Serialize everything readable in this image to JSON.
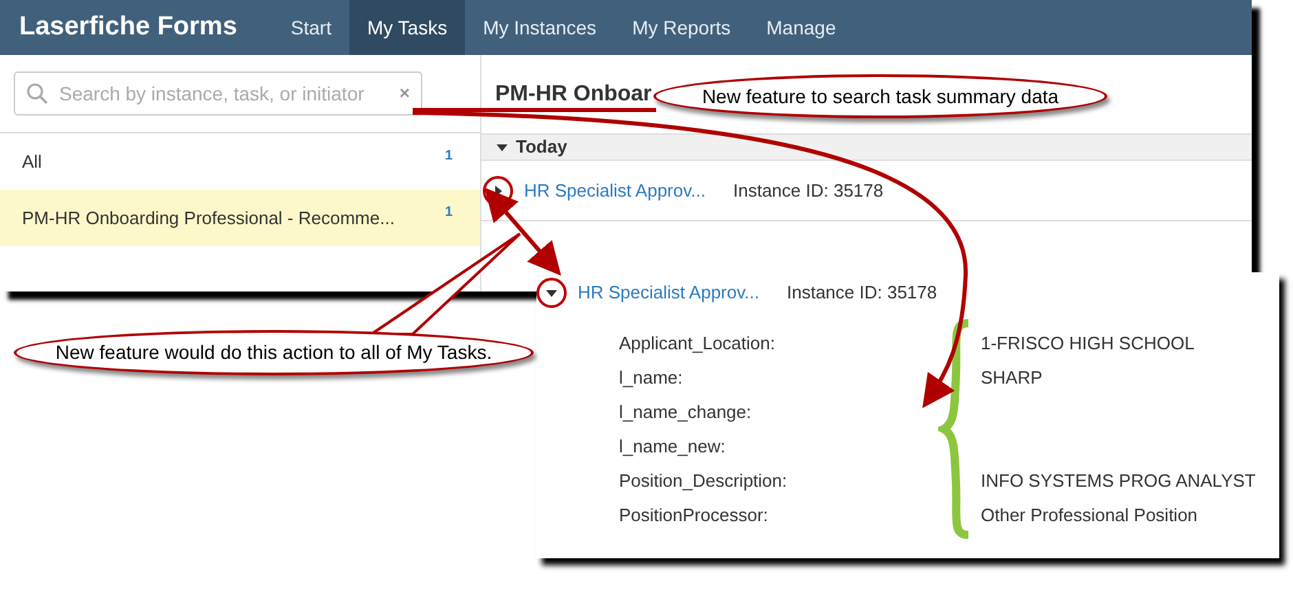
{
  "nav": {
    "logo": "Laserfiche Forms",
    "tabs": [
      {
        "label": "Start",
        "selected": false
      },
      {
        "label": "My Tasks",
        "selected": true
      },
      {
        "label": "My Instances",
        "selected": false
      },
      {
        "label": "My Reports",
        "selected": false
      },
      {
        "label": "Manage",
        "selected": false
      }
    ]
  },
  "sidebar": {
    "search": {
      "placeholder": "Search by instance, task, or initiator",
      "clear": "×"
    },
    "items": [
      {
        "label": "All",
        "count": "1",
        "selected": false
      },
      {
        "label": "PM-HR Onboarding Professional - Recomme...",
        "count": "1",
        "selected": true
      }
    ]
  },
  "main": {
    "title": "PM-HR Onboar",
    "group": {
      "label": "Today",
      "expanded": true
    },
    "task": {
      "name": "HR Specialist Approv...",
      "instance": "Instance ID: 35178",
      "expanded": false
    }
  },
  "detail": {
    "task": {
      "name": "HR Specialist Approv...",
      "instance": "Instance ID: 35178",
      "expanded": true
    },
    "fields": [
      {
        "label": "Applicant_Location:",
        "value": "1-FRISCO HIGH SCHOOL"
      },
      {
        "label": "l_name:",
        "value": "SHARP"
      },
      {
        "label": "l_name_change:"
      },
      {
        "label": "l_name_new:"
      },
      {
        "label": "Position_Description:",
        "value": "INFO SYSTEMS PROG ANALYST"
      },
      {
        "label": "PositionProcessor:",
        "value": "Other Professional Position"
      }
    ]
  },
  "callouts": [
    {
      "text": "New feature to search task summary data"
    },
    {
      "text": "New feature would do this action to all of My Tasks."
    }
  ]
}
